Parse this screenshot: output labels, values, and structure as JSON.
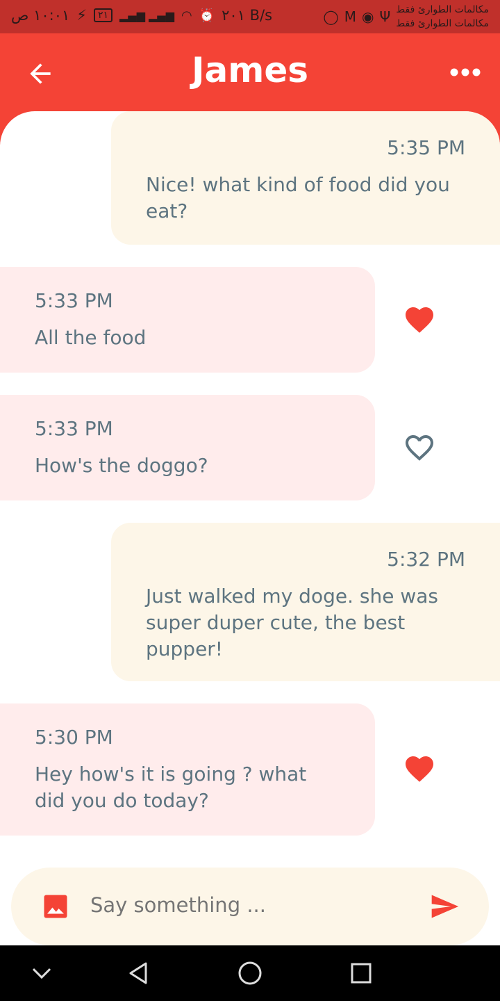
{
  "status_bar": {
    "time": "١٠:٠١ ص",
    "battery": "٢١",
    "network_speed": "٢٠١ B/s",
    "carrier_line1": "مكالمات الطوارئ فقط",
    "carrier_line2": "مكالمات الطوارئ فقط"
  },
  "header": {
    "title": "James",
    "back_icon": "arrow-left-icon",
    "menu_icon": "more-horizontal-icon"
  },
  "messages": [
    {
      "type": "sent",
      "time": "5:35 PM",
      "text": "Nice! what kind of food did you eat?"
    },
    {
      "type": "received",
      "time": "5:33 PM",
      "text": "All the food",
      "liked": true
    },
    {
      "type": "received",
      "time": "5:33 PM",
      "text": "How's the doggo?",
      "liked": false
    },
    {
      "type": "sent",
      "time": "5:32 PM",
      "text": "Just walked my doge. she was super duper cute, the best pupper!"
    },
    {
      "type": "received",
      "time": "5:30 PM",
      "text": "Hey how's it is going ? what did you do today?",
      "liked": true
    }
  ],
  "composer": {
    "placeholder": "Say something ...",
    "image_icon": "image-icon",
    "send_icon": "send-icon"
  },
  "colors": {
    "primary": "#f44336",
    "status_bar": "#c0302b",
    "sent_bubble": "#fdf6e8",
    "received_bubble": "#ffecec",
    "message_text": "#5d7480",
    "heart": "#f44336"
  }
}
